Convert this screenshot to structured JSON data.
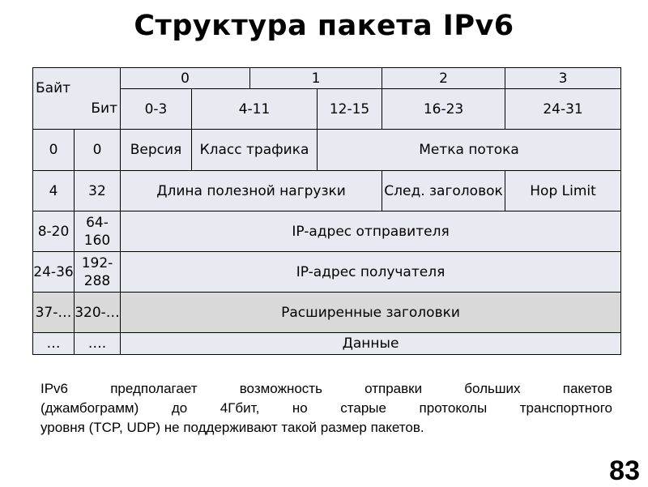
{
  "title": "Структура пакета IPv6",
  "table": {
    "corner": {
      "byte_label": "Байт",
      "bit_label": "Бит"
    },
    "byte_headers": [
      "0",
      "1",
      "2",
      "3"
    ],
    "bit_headers": [
      "0-3",
      "4-11",
      "12-15",
      "16-23",
      "24-31"
    ],
    "rows": [
      {
        "byte": "0",
        "bit": "0",
        "fields": [
          "Версия",
          "Класс трафика",
          "Метка потока"
        ]
      },
      {
        "byte": "4",
        "bit": "32",
        "fields": [
          "Длина полезной нагрузки",
          "След. заголовок",
          "Hop Limit"
        ]
      },
      {
        "byte": "8-20",
        "bit": "64-160",
        "fields": [
          "IP-адрес отправителя"
        ]
      },
      {
        "byte": "24-36",
        "bit": "192-288",
        "fields": [
          "IP-адрес получателя"
        ]
      },
      {
        "byte": "37-…",
        "bit": "320-…",
        "fields": [
          "Расширенные заголовки"
        ]
      },
      {
        "byte": "…",
        "bit": "….",
        "fields": [
          "Данные"
        ]
      }
    ]
  },
  "note": {
    "lines": [
      "IPv6 предполагает возможность отправки больших пакетов",
      "(джамбограмм) до 4Гбит, но старые протоколы транспортного",
      "уровня (TCP, UDP) не поддерживают такой размер пакетов."
    ]
  },
  "page_number": "83",
  "colors": {
    "cell_bg": "#e8eaf2",
    "highlight_bg": "#d9d9d9",
    "border": "#000000"
  }
}
